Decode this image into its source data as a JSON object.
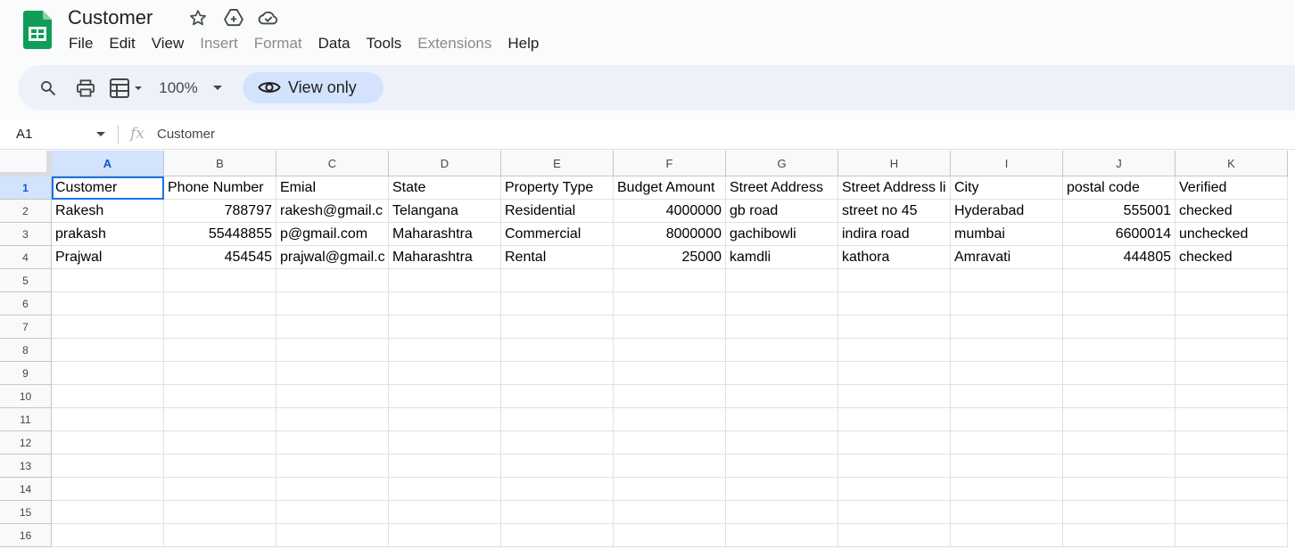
{
  "document": {
    "title": "Customer"
  },
  "menu": [
    "File",
    "Edit",
    "View",
    "Insert",
    "Format",
    "Data",
    "Tools",
    "Extensions",
    "Help"
  ],
  "menu_disabled": [
    false,
    false,
    false,
    true,
    true,
    false,
    false,
    true,
    false
  ],
  "toolbar": {
    "zoom": "100%",
    "view_mode": "View only"
  },
  "formula_bar": {
    "name_box": "A1",
    "content": "Customer"
  },
  "grid": {
    "columns": [
      "A",
      "B",
      "C",
      "D",
      "E",
      "F",
      "G",
      "H",
      "I",
      "J",
      "K"
    ],
    "row_numbers": [
      "1",
      "2",
      "3",
      "4",
      "5",
      "6",
      "7",
      "8",
      "9",
      "10",
      "11",
      "12",
      "13",
      "14",
      "15",
      "16"
    ],
    "rows": [
      [
        "Customer",
        "Phone Number",
        "Emial",
        "State",
        "Property Type",
        "Budget Amount",
        "Street Address",
        "Street Address li",
        "City",
        "postal code",
        "Verified"
      ],
      [
        "Rakesh",
        "788797",
        "rakesh@gmail.c",
        "Telangana",
        "Residential",
        "4000000",
        "gb road",
        "street no 45",
        "Hyderabad",
        "555001",
        "checked"
      ],
      [
        "prakash",
        "55448855",
        "p@gmail.com",
        "Maharashtra",
        "Commercial",
        "8000000",
        "gachibowli",
        "indira road",
        "mumbai",
        "6600014",
        "unchecked"
      ],
      [
        "Prajwal",
        "454545",
        "prajwal@gmail.c",
        "Maharashtra",
        "Rental",
        "25000",
        "kamdli",
        "kathora",
        "Amravati",
        "444805",
        "checked"
      ]
    ],
    "selected_cell": "A1"
  },
  "colors": {
    "accent": "#1a73e8",
    "selection_header": "#d3e3fd",
    "sheets_green": "#0f9d58"
  }
}
